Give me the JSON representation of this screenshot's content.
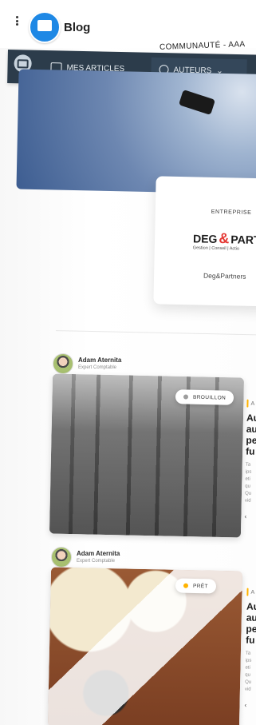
{
  "header": {
    "title": "Blog",
    "community": "COMMUNAUTÉ - AAA"
  },
  "nav": {
    "items": [
      {
        "label": "MES ARTICLES"
      },
      {
        "label": "AUTEURS"
      }
    ]
  },
  "company": {
    "label": "ENTREPRISE",
    "logo": {
      "text_left": "DEG",
      "text_amp": "&",
      "text_right": "PARTNERS",
      "subtitle": "Gestion | Conseil | Actio"
    },
    "name": "Deg&Partners"
  },
  "posts": [
    {
      "author": {
        "name": "Adam Aternita",
        "role": "Expert Comptable"
      },
      "status": {
        "label": "BROUILLON",
        "color": "#9e9e9e"
      },
      "preview": {
        "tag": "A",
        "title": "Au\nau\npe\nfu",
        "excerpt": "Ta\nips\neti\nqu\nQu\nvid",
        "more": "‹"
      }
    },
    {
      "author": {
        "name": "Adam Aternita",
        "role": "Expert Comptable"
      },
      "status": {
        "label": "PRÊT",
        "color": "#ffb300"
      },
      "preview": {
        "tag": "A",
        "title": "Au\nau\npe\nfu",
        "excerpt": "Ta\nips\neti\nqu\nQu\nvid",
        "more": "‹"
      }
    }
  ],
  "colors": {
    "nav_bg": "#2c3c4b",
    "accent_status_draft": "#9e9e9e",
    "accent_status_ready": "#ffb300",
    "logo_accent": "#e53935"
  },
  "icons": {
    "menu": "kebab-menu-icon",
    "app": "blog-app-icon",
    "chat": "chat-icon",
    "articles": "articles-icon",
    "authors": "authors-icon",
    "dropdown": "chevron-down-icon",
    "status_dot": "status-dot-icon"
  }
}
